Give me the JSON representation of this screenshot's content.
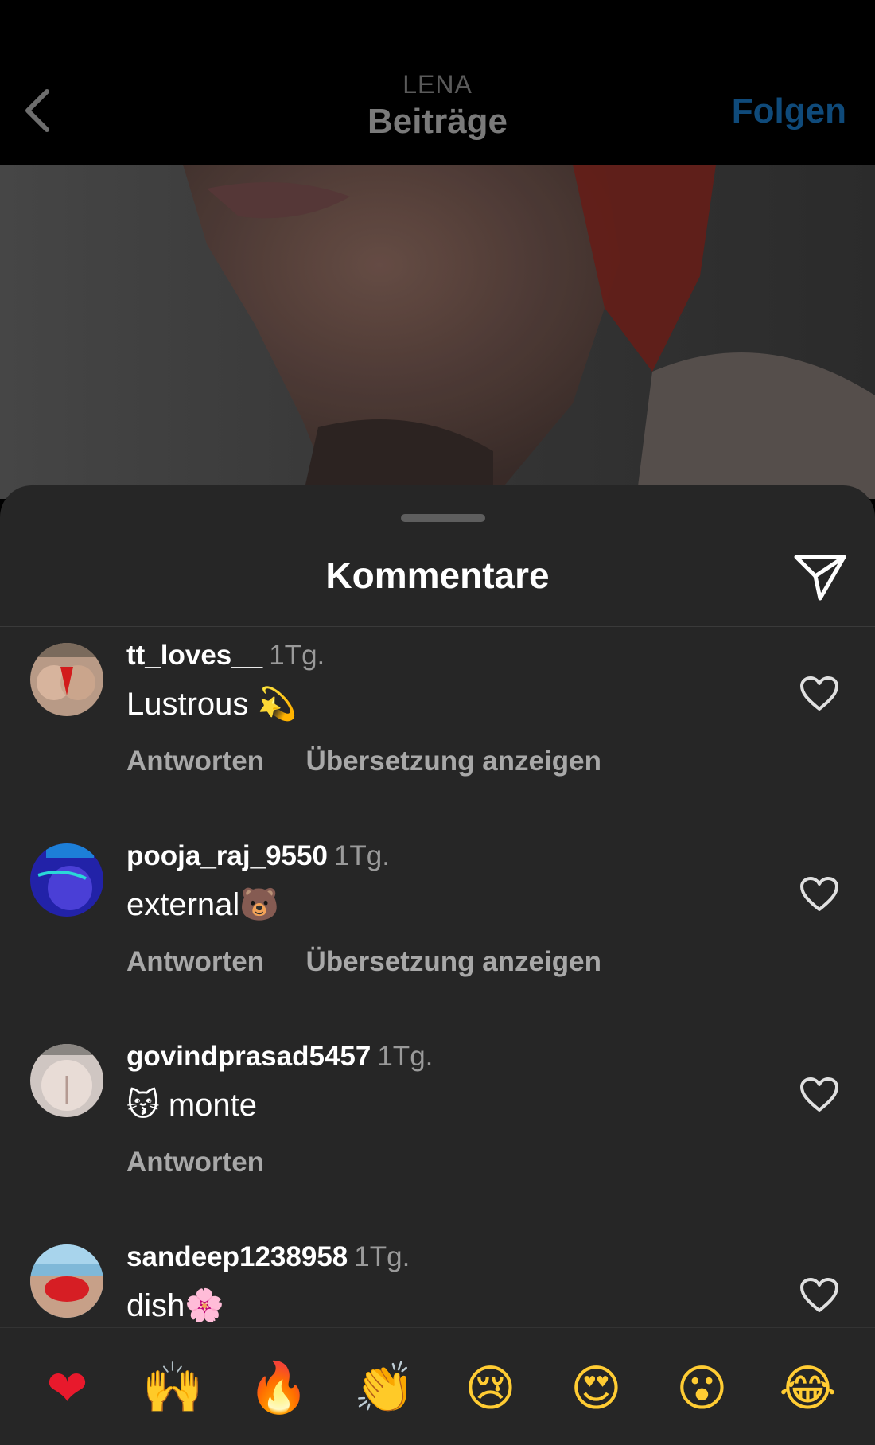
{
  "nav": {
    "subtitle": "LENA",
    "title": "Beiträge",
    "follow_label": "Folgen"
  },
  "sheet": {
    "title": "Kommentare"
  },
  "comments": [
    {
      "username": "tt_loves__",
      "time": "1Tg.",
      "text": "Lustrous",
      "emoji": "💫",
      "actions": [
        "Antworten",
        "Übersetzung anzeigen"
      ]
    },
    {
      "username": "pooja_raj_9550",
      "time": "1Tg.",
      "text": "external",
      "emoji": "🐻",
      "actions": [
        "Antworten",
        "Übersetzung anzeigen"
      ]
    },
    {
      "username": "govindprasad5457",
      "time": "1Tg.",
      "emoji_prefix": "😽",
      "text": "monte",
      "actions": [
        "Antworten"
      ]
    },
    {
      "username": "sandeep1238958",
      "time": "1Tg.",
      "text": "dish",
      "emoji": "🌸",
      "actions": []
    }
  ],
  "reactions": [
    "❤",
    "🙌",
    "🔥",
    "👏",
    "😢",
    "😍",
    "😮",
    "😂"
  ],
  "icons": {
    "back": "chevron-left-icon",
    "share": "paper-plane-icon",
    "like": "heart-outline-icon"
  },
  "colors": {
    "sheet_bg": "#262626",
    "follow": "#0f4a7a",
    "secondary_text": "#a8a8a8"
  }
}
